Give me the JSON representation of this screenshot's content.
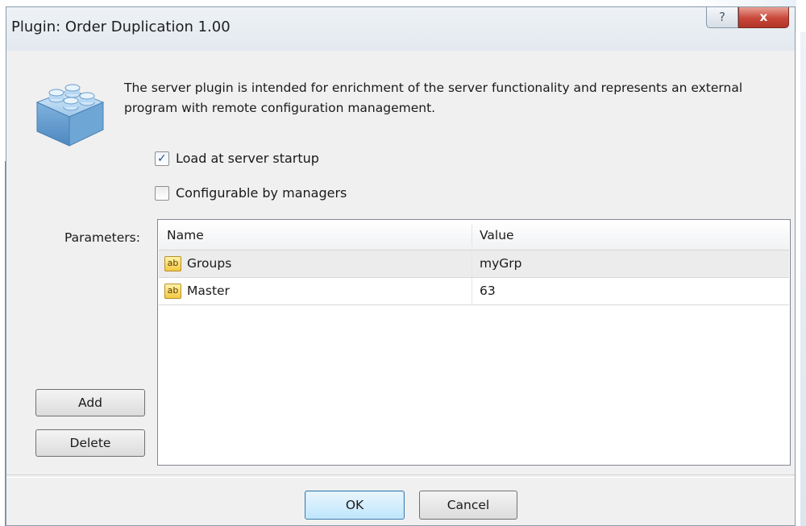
{
  "window": {
    "title": "Plugin: Order Duplication 1.00",
    "help_glyph": "?",
    "close_glyph": "x"
  },
  "description": {
    "line1": "The server plugin is intended for enrichment of the server functionality and represents an external",
    "line2": "program with remote configuration management."
  },
  "options": [
    {
      "label": "Load at server startup",
      "checked": true
    },
    {
      "label": "Configurable by managers",
      "checked": false
    }
  ],
  "parameters": {
    "label": "Parameters:",
    "columns": [
      "Name",
      "Value"
    ],
    "rows": [
      {
        "icon": "string-value-icon",
        "icon_text": "ab",
        "name": "Groups",
        "value": "myGrp",
        "selected": true
      },
      {
        "icon": "string-value-icon",
        "icon_text": "ab",
        "name": "Master",
        "value": "63",
        "selected": false
      }
    ]
  },
  "buttons": {
    "add": "Add",
    "delete": "Delete",
    "ok": "OK",
    "cancel": "Cancel"
  },
  "colors": {
    "window_bg": "#f0f0f0",
    "ok_accent": "#3c7fb1",
    "close_red": "#c9463a"
  }
}
